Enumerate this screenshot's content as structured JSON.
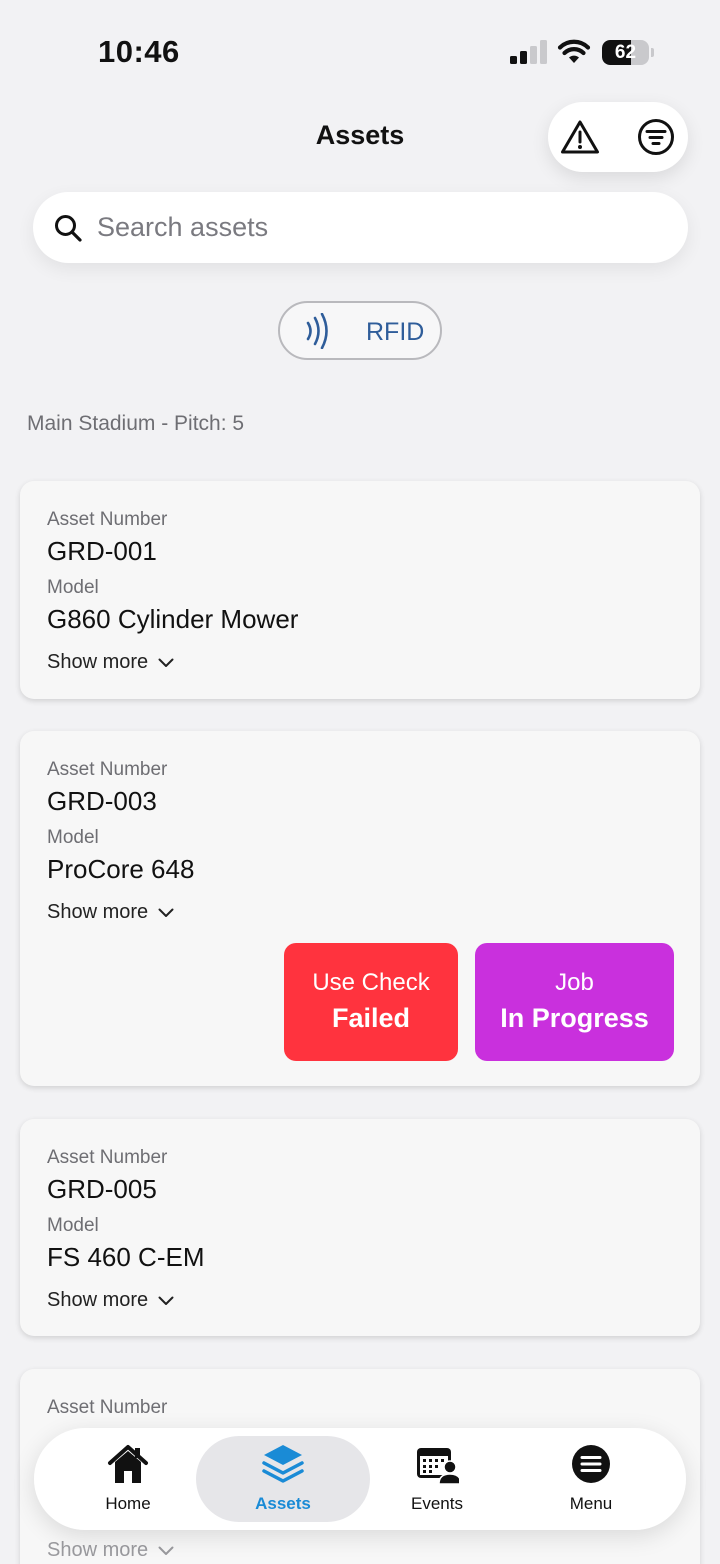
{
  "status_bar": {
    "time": "10:46",
    "battery": "62",
    "battery_level": 0.62
  },
  "header": {
    "title": "Assets"
  },
  "search": {
    "placeholder": "Search assets",
    "value": ""
  },
  "rfid": {
    "label": "RFID"
  },
  "location": "Main Stadium - Pitch: 5",
  "cards": [
    {
      "asset_label": "Asset Number",
      "asset": "GRD-001",
      "model_label": "Model",
      "model": "G860 Cylinder Mower",
      "more": "Show more"
    },
    {
      "asset_label": "Asset Number",
      "asset": "GRD-003",
      "model_label": "Model",
      "model": "ProCore 648",
      "more": "Show more",
      "statuses": [
        {
          "line1": "Use Check",
          "line2": "Failed",
          "color": "#ff333e"
        },
        {
          "line1": "Job",
          "line2": "In Progress",
          "color": "#c930dd"
        }
      ]
    },
    {
      "asset_label": "Asset Number",
      "asset": "GRD-005",
      "model_label": "Model",
      "model": "FS 460 C-EM",
      "more": "Show more"
    },
    {
      "asset_label": "Asset Number",
      "more": "Show more"
    }
  ],
  "nav": {
    "items": [
      {
        "label": "Home",
        "icon": "home-icon"
      },
      {
        "label": "Assets",
        "icon": "layers-icon",
        "active": true
      },
      {
        "label": "Events",
        "icon": "events-icon"
      },
      {
        "label": "Menu",
        "icon": "menu-icon"
      }
    ]
  },
  "colors": {
    "accent": "#1a8bd6",
    "rfid": "#2f5d9a",
    "failed": "#ff333e",
    "in_progress": "#c930dd"
  }
}
